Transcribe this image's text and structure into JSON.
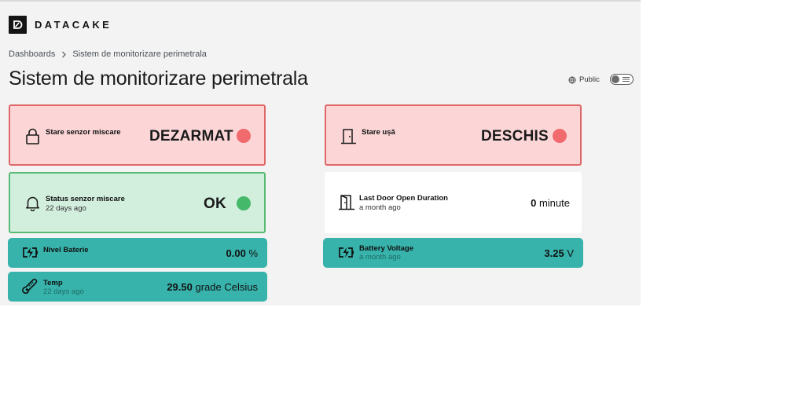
{
  "brand": {
    "name": "DATACAKE"
  },
  "breadcrumb": {
    "root": "Dashboards",
    "current": "Sistem de monitorizare perimetrala"
  },
  "page": {
    "title": "Sistem de monitorizare perimetrala"
  },
  "visibility": {
    "label": "Public",
    "toggle_on": false
  },
  "colors": {
    "alarm_red": "#f06a6e",
    "ok_green": "#46b86a",
    "teal": "#37b3ab",
    "red_bg": "#fcd6d7",
    "green_bg": "#d2eedd"
  },
  "widgets": {
    "motion_state": {
      "icon": "lock-icon",
      "title": "Stare senzor miscare",
      "state": "DEZARMAT"
    },
    "door_state": {
      "icon": "door-icon",
      "title": "Stare ușă",
      "state": "DESCHIS"
    },
    "motion_status": {
      "icon": "bell-icon",
      "title": "Status senzor miscare",
      "updated": "22 days ago",
      "state": "OK"
    },
    "door_duration": {
      "icon": "door-open-icon",
      "title": "Last Door Open Duration",
      "updated": "a month ago",
      "value": "0",
      "unit": "minute"
    },
    "battery_level": {
      "icon": "battery-charging-icon",
      "title": "Nivel Baterie",
      "value": "0.00",
      "unit": "%"
    },
    "battery_voltage": {
      "icon": "battery-charging-icon",
      "title": "Battery Voltage",
      "updated": "a month ago",
      "value": "3.25",
      "unit": "V"
    },
    "temp": {
      "icon": "thermometer-icon",
      "title": "Temp",
      "updated": "22 days ago",
      "value": "29.50",
      "unit": "grade Celsius"
    }
  }
}
